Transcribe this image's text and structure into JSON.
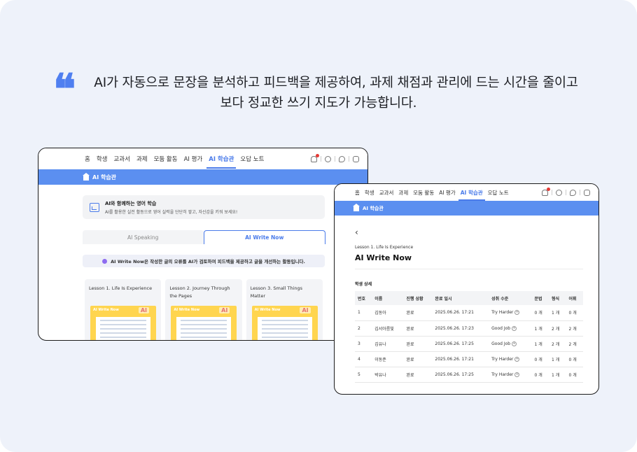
{
  "quote": {
    "line1": "AI가 자동으로 문장을 분석하고 피드백을 제공하여, 과제 채점과 관리에 드는 시간을 줄이고",
    "line2": "보다 정교한 쓰기 지도가 가능합니다.",
    "mark": "❝"
  },
  "window1": {
    "nav": [
      "홈",
      "학생",
      "교과서",
      "과제",
      "모둠 활동",
      "AI 평가",
      "AI 학습관",
      "오답 노트"
    ],
    "active_nav": "AI 학습관",
    "bar_title": "AI 학습관",
    "info_title": "AI와 함께하는 영어 학습",
    "info_desc": "AI를 활용한 실전 활동으로 영어 실력을 단단히 쌓고, 자신감을 키워 보세요!",
    "tabs": [
      "AI Speaking",
      "AI Write Now"
    ],
    "notice": "AI Write Now은 작성한 글의 오류를 AI가 검토하여 피드백을 제공하고 글을 개선하는 활동입니다.",
    "lessons": [
      {
        "title": "Lesson 1. Life Is Experience"
      },
      {
        "title": "Lesson 2. Journey Through the Pages"
      },
      {
        "title": "Lesson 3. Small Things Matter"
      }
    ],
    "thumb_brand": "AI Write Now",
    "thumb_ai": "AI"
  },
  "window2": {
    "nav": [
      "홈",
      "학생",
      "교과서",
      "과제",
      "모둠 활동",
      "AI 평가",
      "AI 학습관",
      "오답 노트"
    ],
    "bar_title": "AI 학습관",
    "back": "‹",
    "crumb": "Lesson 1. Life Is Experience",
    "title": "AI Write Now",
    "subhead": "학생 상세",
    "columns": [
      "번호",
      "이름",
      "진행 상황",
      "완료 일시",
      "성취 수준",
      "문법",
      "형식",
      "어휘"
    ],
    "rows": [
      {
        "no": "1",
        "name": "김동아",
        "status": "완료",
        "date": "2025.06.26. 17:21",
        "level": "Try Harder",
        "grammar": "0 개",
        "form": "1 개",
        "vocab": "0 개"
      },
      {
        "no": "2",
        "name": "김서아름빛",
        "status": "완료",
        "date": "2025.06.26. 17:23",
        "level": "Good Job",
        "grammar": "1 개",
        "form": "2 개",
        "vocab": "2 개"
      },
      {
        "no": "3",
        "name": "김유나",
        "status": "완료",
        "date": "2025.06.26. 17:25",
        "level": "Good Job",
        "grammar": "1 개",
        "form": "2 개",
        "vocab": "2 개"
      },
      {
        "no": "4",
        "name": "이동준",
        "status": "완료",
        "date": "2025.06.26. 17:21",
        "level": "Try Harder",
        "grammar": "0 개",
        "form": "1 개",
        "vocab": "0 개"
      },
      {
        "no": "5",
        "name": "박유나",
        "status": "완료",
        "date": "2025.06.26. 17:25",
        "level": "Try Harder",
        "grammar": "0 개",
        "form": "1 개",
        "vocab": "0 개"
      }
    ]
  },
  "colors": {
    "accent": "#4a7bea",
    "bar": "#5b8ff0",
    "quote": "#4f7ff0",
    "background": "#eef2fa"
  }
}
